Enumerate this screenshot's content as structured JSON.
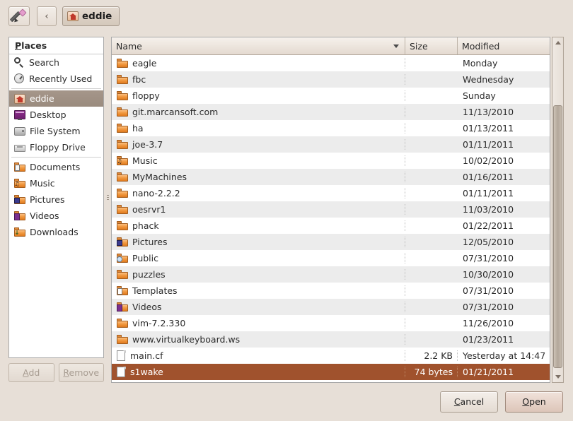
{
  "window": {
    "background_color": "#e7dfd7",
    "title": "eddie"
  },
  "toolbar": {
    "edit_icon": "pencil-icon",
    "back_label": "‹",
    "path_button_label": "eddie",
    "path_button_icon": "home-folder-icon"
  },
  "sidebar": {
    "header": "Places",
    "header_mnemonic": "P",
    "header_rest": "laces",
    "items": [
      {
        "label": "Search",
        "icon": "search-icon",
        "selected": false,
        "separator_after": false
      },
      {
        "label": "Recently Used",
        "icon": "clock-icon",
        "selected": false,
        "separator_after": true
      },
      {
        "label": "eddie",
        "icon": "home-folder-icon",
        "selected": true,
        "separator_after": false
      },
      {
        "label": "Desktop",
        "icon": "desktop-icon",
        "selected": false,
        "separator_after": false
      },
      {
        "label": "File System",
        "icon": "hard-drive-icon",
        "selected": false,
        "separator_after": false
      },
      {
        "label": "Floppy Drive",
        "icon": "floppy-drive-icon",
        "selected": false,
        "separator_after": true
      },
      {
        "label": "Documents",
        "icon": "documents-folder-icon",
        "selected": false,
        "separator_after": false
      },
      {
        "label": "Music",
        "icon": "music-folder-icon",
        "selected": false,
        "separator_after": false
      },
      {
        "label": "Pictures",
        "icon": "pictures-folder-icon",
        "selected": false,
        "separator_after": false
      },
      {
        "label": "Videos",
        "icon": "videos-folder-icon",
        "selected": false,
        "separator_after": false
      },
      {
        "label": "Downloads",
        "icon": "downloads-folder-icon",
        "selected": false,
        "separator_after": false
      }
    ],
    "add_button": {
      "label": "Add",
      "mnemonic": "A",
      "rest": "dd",
      "enabled": false
    },
    "remove_button": {
      "label": "Remove",
      "mnemonic": "R",
      "rest": "emove",
      "enabled": false
    }
  },
  "file_list": {
    "columns": [
      {
        "key": "name",
        "label": "Name",
        "sort_indicator": "chevron-down-icon"
      },
      {
        "key": "size",
        "label": "Size",
        "sort_indicator": ""
      },
      {
        "key": "modified",
        "label": "Modified",
        "sort_indicator": ""
      }
    ],
    "rows": [
      {
        "name": "eagle",
        "size": "",
        "modified": "Monday",
        "icon": "folder-icon",
        "selected": false
      },
      {
        "name": "fbc",
        "size": "",
        "modified": "Wednesday",
        "icon": "folder-icon",
        "selected": false
      },
      {
        "name": "floppy",
        "size": "",
        "modified": "Sunday",
        "icon": "folder-icon",
        "selected": false
      },
      {
        "name": "git.marcansoft.com",
        "size": "",
        "modified": "11/13/2010",
        "icon": "folder-icon",
        "selected": false
      },
      {
        "name": "ha",
        "size": "",
        "modified": "01/13/2011",
        "icon": "folder-icon",
        "selected": false
      },
      {
        "name": "joe-3.7",
        "size": "",
        "modified": "01/11/2011",
        "icon": "folder-icon",
        "selected": false
      },
      {
        "name": "Music",
        "size": "",
        "modified": "10/02/2010",
        "icon": "music-folder-icon",
        "selected": false
      },
      {
        "name": "MyMachines",
        "size": "",
        "modified": "01/16/2011",
        "icon": "folder-icon",
        "selected": false
      },
      {
        "name": "nano-2.2.2",
        "size": "",
        "modified": "01/11/2011",
        "icon": "folder-icon",
        "selected": false
      },
      {
        "name": "oesrvr1",
        "size": "",
        "modified": "11/03/2010",
        "icon": "folder-icon",
        "selected": false
      },
      {
        "name": "phack",
        "size": "",
        "modified": "01/22/2011",
        "icon": "folder-icon",
        "selected": false
      },
      {
        "name": "Pictures",
        "size": "",
        "modified": "12/05/2010",
        "icon": "pictures-folder-icon",
        "selected": false
      },
      {
        "name": "Public",
        "size": "",
        "modified": "07/31/2010",
        "icon": "public-folder-icon",
        "selected": false
      },
      {
        "name": "puzzles",
        "size": "",
        "modified": "10/30/2010",
        "icon": "folder-icon",
        "selected": false
      },
      {
        "name": "Templates",
        "size": "",
        "modified": "07/31/2010",
        "icon": "templates-folder-icon",
        "selected": false
      },
      {
        "name": "Videos",
        "size": "",
        "modified": "07/31/2010",
        "icon": "videos-folder-icon",
        "selected": false
      },
      {
        "name": "vim-7.2.330",
        "size": "",
        "modified": "11/26/2010",
        "icon": "folder-icon",
        "selected": false
      },
      {
        "name": "www.virtualkeyboard.ws",
        "size": "",
        "modified": "01/23/2011",
        "icon": "folder-icon",
        "selected": false
      },
      {
        "name": "main.cf",
        "size": "2.2 KB",
        "modified": "Yesterday at 14:47",
        "icon": "file-icon",
        "selected": false
      },
      {
        "name": "s1wake",
        "size": "74 bytes",
        "modified": "01/21/2011",
        "icon": "file-icon",
        "selected": true
      }
    ],
    "selection_color": "#a0522d",
    "row_alt_color": "#ececec"
  },
  "scrollbar": {
    "up_arrow": "chevron-up-icon",
    "down_arrow": "chevron-down-icon"
  },
  "actions": {
    "cancel": {
      "label": "Cancel",
      "mnemonic": "C",
      "rest": "ancel"
    },
    "open": {
      "label": "Open",
      "mnemonic": "O",
      "rest": "pen"
    }
  }
}
